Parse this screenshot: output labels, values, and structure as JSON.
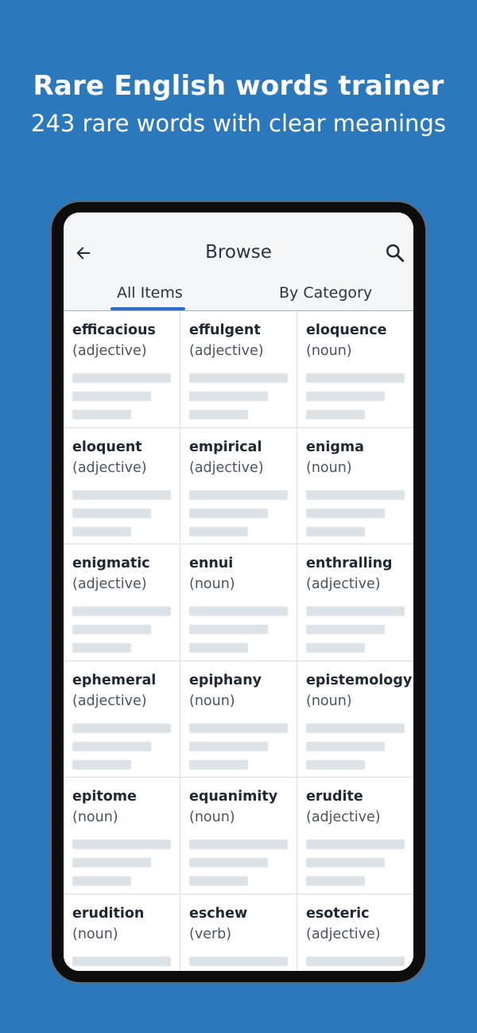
{
  "headline": {
    "title": "Rare English words trainer",
    "subtitle": "243 rare words with clear meanings"
  },
  "app_bar": {
    "title": "Browse",
    "back_icon": "arrow-left-icon",
    "search_icon": "search-icon"
  },
  "tabs": [
    {
      "label": "All Items",
      "selected": true
    },
    {
      "label": "By Category",
      "selected": false
    }
  ],
  "words": [
    {
      "word": "efficacious",
      "pos": "(adjective)"
    },
    {
      "word": "effulgent",
      "pos": "(adjective)"
    },
    {
      "word": "eloquence",
      "pos": "(noun)"
    },
    {
      "word": "eloquent",
      "pos": "(adjective)"
    },
    {
      "word": "empirical",
      "pos": "(adjective)"
    },
    {
      "word": "enigma",
      "pos": "(noun)"
    },
    {
      "word": "enigmatic",
      "pos": "(adjective)"
    },
    {
      "word": "ennui",
      "pos": "(noun)"
    },
    {
      "word": "enthralling",
      "pos": "(adjective)"
    },
    {
      "word": "ephemeral",
      "pos": "(adjective)"
    },
    {
      "word": "epiphany",
      "pos": "(noun)"
    },
    {
      "word": "epistemology",
      "pos": "(noun)"
    },
    {
      "word": "epitome",
      "pos": "(noun)"
    },
    {
      "word": "equanimity",
      "pos": "(noun)"
    },
    {
      "word": "erudite",
      "pos": "(adjective)"
    },
    {
      "word": "erudition",
      "pos": "(noun)"
    },
    {
      "word": "eschew",
      "pos": "(verb)"
    },
    {
      "word": "esoteric",
      "pos": "(adjective)"
    }
  ],
  "colors": {
    "background": "#2b79bc",
    "tab_indicator": "#2a6fc9",
    "placeholder_bar": "#dde2e7"
  }
}
